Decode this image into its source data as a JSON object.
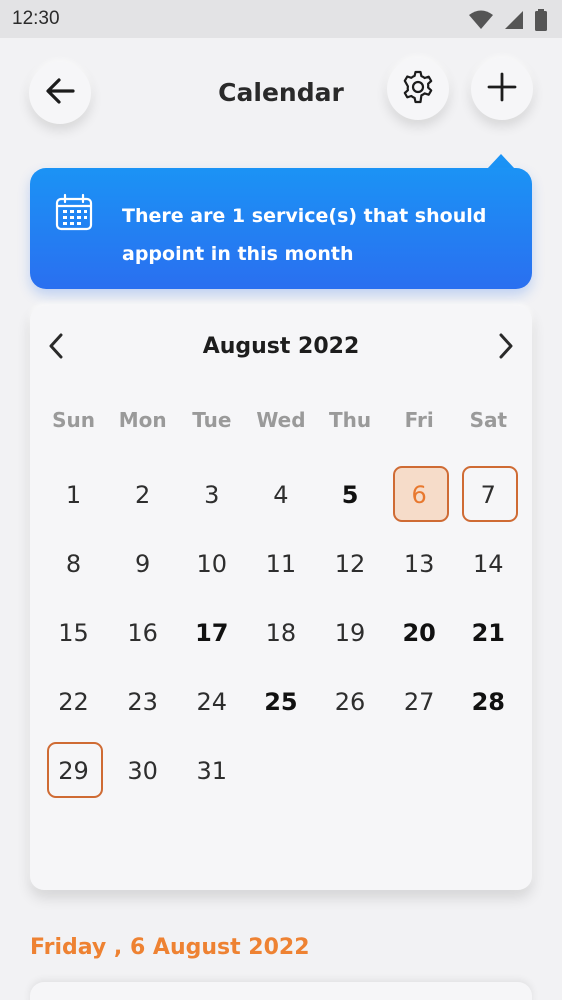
{
  "status_bar": {
    "time": "12:30"
  },
  "header": {
    "title": "Calendar"
  },
  "banner": {
    "message": "There are 1 service(s) that should appoint in this month"
  },
  "calendar": {
    "month_label": "August 2022",
    "weekdays": [
      "Sun",
      "Mon",
      "Tue",
      "Wed",
      "Thu",
      "Fri",
      "Sat"
    ],
    "first_weekday_index": 0,
    "days_in_month": 31,
    "selected_day": 6,
    "outlined_days": [
      7,
      29
    ],
    "bold_days": [
      5,
      17,
      20,
      21,
      25,
      28
    ]
  },
  "selected_date_label": "Friday , 6 August 2022",
  "colors": {
    "accent_orange": "#ee8232",
    "banner_blue": "#1b93f5"
  }
}
